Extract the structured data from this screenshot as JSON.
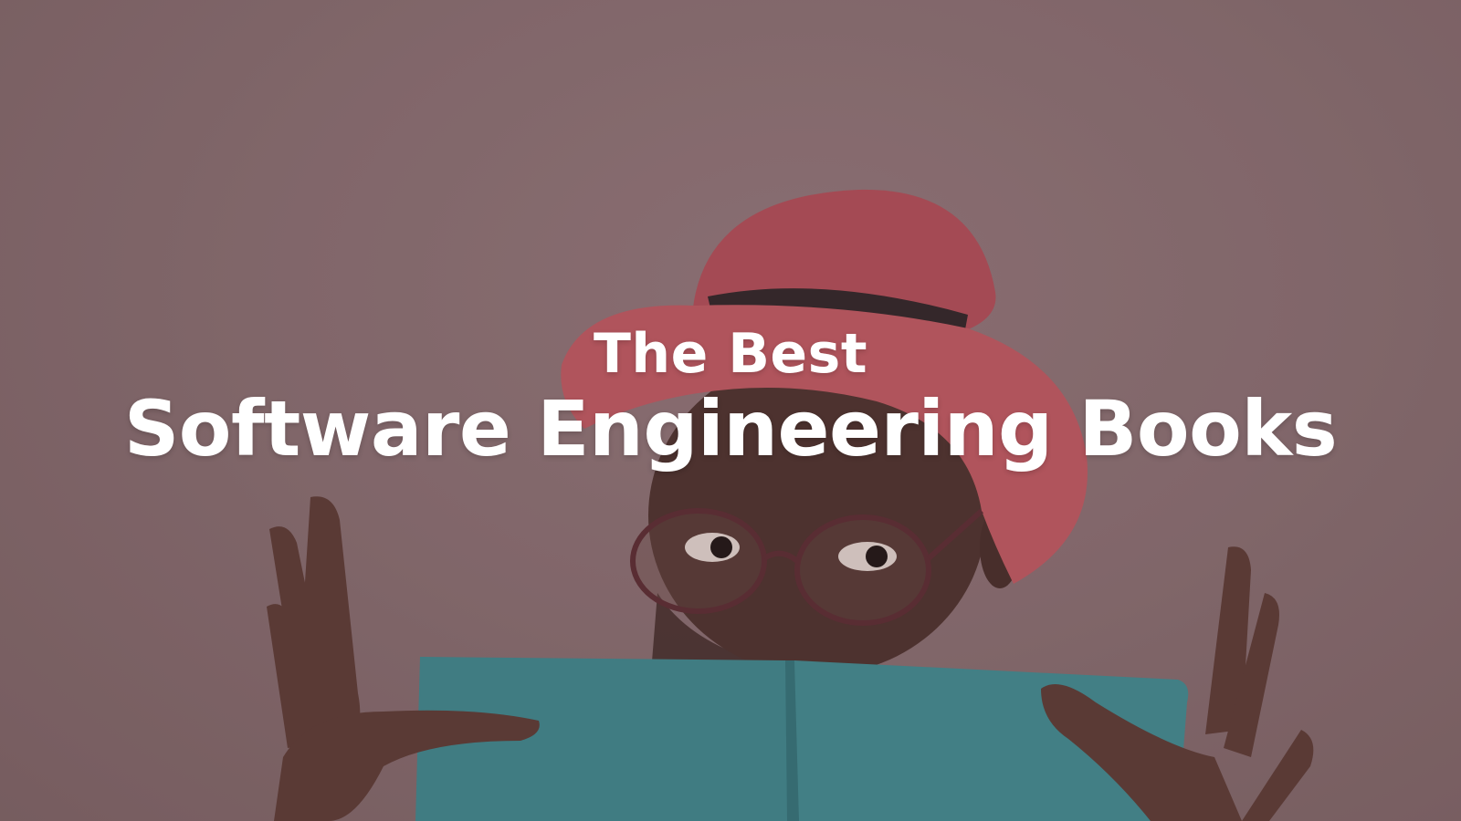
{
  "hero": {
    "kicker": "The Best",
    "title": "Software Engineering Books"
  },
  "colors": {
    "background": "#8a7173",
    "hat": "#c1555f",
    "hat_band": "#2e2527",
    "skin": "#4a2f2a",
    "book": "#3d8a90",
    "text": "#ffffff"
  },
  "illustration": {
    "subject": "person-in-hat-reading-book-icon"
  }
}
